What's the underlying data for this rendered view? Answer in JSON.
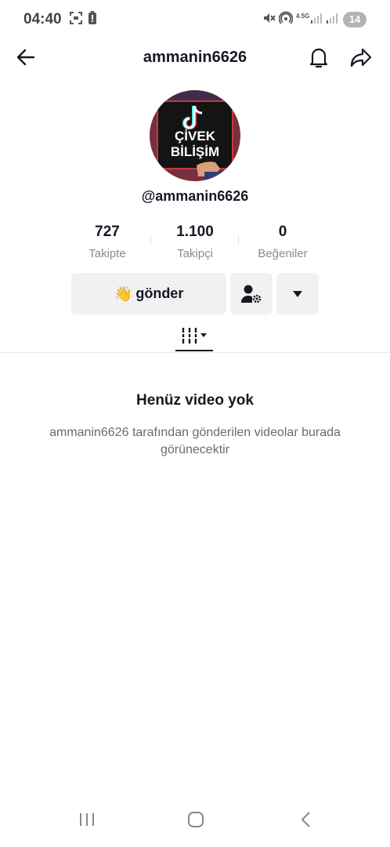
{
  "status_bar": {
    "time": "04:40",
    "network": "4.5G",
    "battery": "14"
  },
  "header": {
    "title": "ammanin6626"
  },
  "avatar": {
    "line1": "ÇİVEK",
    "line2": "BİLİŞİM"
  },
  "profile": {
    "handle": "@ammanin6626"
  },
  "stats": [
    {
      "value": "727",
      "label": "Takipte"
    },
    {
      "value": "1.100",
      "label": "Takipçi"
    },
    {
      "value": "0",
      "label": "Beğeniler"
    }
  ],
  "actions": {
    "send_emoji": "👋",
    "send_label": "gönder"
  },
  "empty_state": {
    "title": "Henüz video yok",
    "description": "ammanin6626 tarafından gönderilen videolar burada görünecektir"
  },
  "colors": {
    "text": "#161823",
    "muted": "#8a8b91",
    "button_bg": "#f1f1f2"
  }
}
